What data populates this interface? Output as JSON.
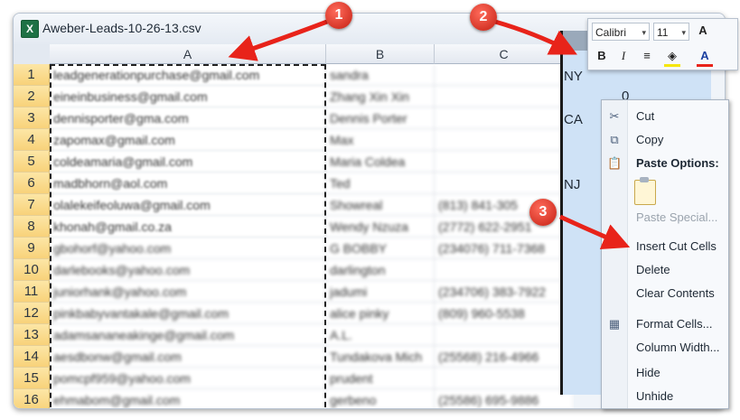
{
  "window": {
    "title": "Aweber-Leads-10-26-13.csv",
    "icon": "excel-icon"
  },
  "columns": [
    {
      "label": "A",
      "selected": false
    },
    {
      "label": "B",
      "selected": false
    },
    {
      "label": "C",
      "selected": false
    }
  ],
  "rows": [
    {
      "num": "1",
      "a": "leadgenerationpurchase@gmail.com",
      "b": "sandra",
      "c": ""
    },
    {
      "num": "2",
      "a": "eineinbusiness@gmail.com",
      "b": "Zhang Xin Xin",
      "c": ""
    },
    {
      "num": "3",
      "a": "dennisporter@gma.com",
      "b": "Dennis Porter",
      "c": ""
    },
    {
      "num": "4",
      "a": "zapomax@gmail.com",
      "b": "Max",
      "c": ""
    },
    {
      "num": "5",
      "a": "coldeamaria@gmail.com",
      "b": "Maria Coldea",
      "c": ""
    },
    {
      "num": "6",
      "a": "madbhorn@aol.com",
      "b": "Ted",
      "c": ""
    },
    {
      "num": "7",
      "a": "olalekeifeoluwa@gmail.com",
      "b": "Showreal",
      "c": "(813) 841-305"
    },
    {
      "num": "8",
      "a": "khonah@gmail.co.za",
      "b": "Wendy Nzuza",
      "c": "(2772) 622-2951"
    },
    {
      "num": "9",
      "a": "gbohorf@yahoo.com",
      "b": "G BOBBY",
      "c": "(234076) 711-7368"
    },
    {
      "num": "10",
      "a": "darlebooks@yahoo.com",
      "b": "darlington",
      "c": ""
    },
    {
      "num": "11",
      "a": "juniorhank@yahoo.com",
      "b": "jadumi",
      "c": "(234706) 383-7922"
    },
    {
      "num": "12",
      "a": "pinkbabyvantakale@gmail.com",
      "b": "alice pinky",
      "c": "(809) 960-5538"
    },
    {
      "num": "13",
      "a": "adamsananeakinge@gmail.com",
      "b": "A.L.",
      "c": ""
    },
    {
      "num": "14",
      "a": "aesdbonw@gmail.com",
      "b": "Tundakova Mich",
      "c": "(25568) 216-4966"
    },
    {
      "num": "15",
      "a": "pomcpf959@yahoo.com",
      "b": "prudent",
      "c": ""
    },
    {
      "num": "16",
      "a": "ehmabom@gmail.com",
      "b": "gerbeno",
      "c": "(25586) 695-9886"
    }
  ],
  "right_column": {
    "cells": [
      "NY",
      "0",
      "CA",
      "NJ"
    ]
  },
  "mini_toolbar": {
    "font": "Calibri",
    "size": "11",
    "grow": "A",
    "bold": "B",
    "italic": "I",
    "align": "≡",
    "fill": "◈",
    "font_color": "A"
  },
  "context_menu": {
    "items": [
      {
        "label": "Cut",
        "icon": "scissors-icon",
        "glyph": "✂",
        "style": "normal"
      },
      {
        "label": "Copy",
        "icon": "copy-icon",
        "glyph": "⧉",
        "style": "normal"
      },
      {
        "label": "Paste Options:",
        "icon": "paste-icon",
        "glyph": "📋",
        "style": "bold"
      },
      {
        "label": "Paste Special...",
        "icon": "",
        "glyph": "",
        "style": "disabled"
      },
      {
        "label": "Insert Cut Cells",
        "icon": "",
        "glyph": "",
        "style": "normal"
      },
      {
        "label": "Delete",
        "icon": "",
        "glyph": "",
        "style": "normal"
      },
      {
        "label": "Clear Contents",
        "icon": "",
        "glyph": "",
        "style": "normal"
      },
      {
        "label": "Format Cells...",
        "icon": "format-cells-icon",
        "glyph": "▦",
        "style": "normal"
      },
      {
        "label": "Column Width...",
        "icon": "",
        "glyph": "",
        "style": "normal"
      },
      {
        "label": "Hide",
        "icon": "",
        "glyph": "",
        "style": "normal"
      },
      {
        "label": "Unhide",
        "icon": "",
        "glyph": "",
        "style": "normal"
      }
    ]
  },
  "callouts": [
    "1",
    "2",
    "3"
  ],
  "colors": {
    "arrow": "#e8231a",
    "row_header": "#f8d27a",
    "selection": "#cfe2f6"
  }
}
